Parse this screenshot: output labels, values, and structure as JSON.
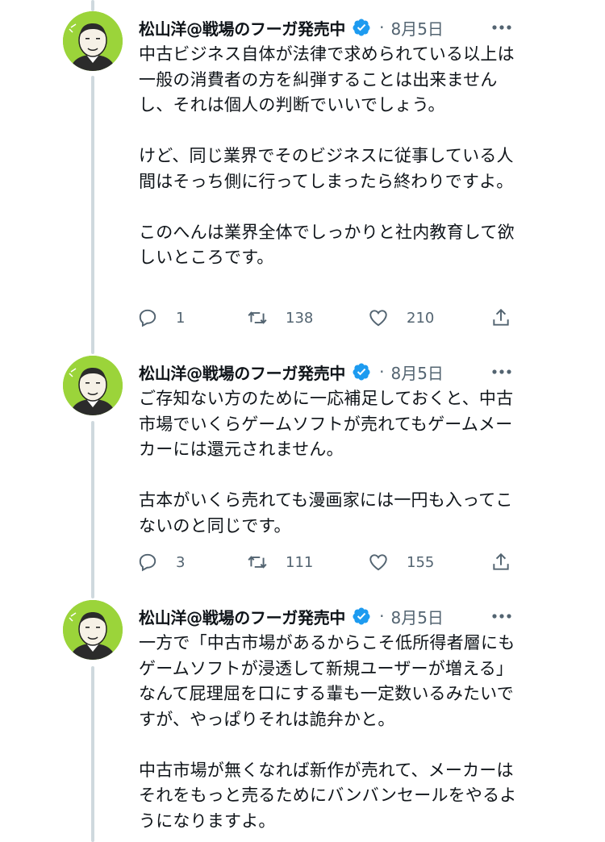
{
  "colors": {
    "verified": "#1d9bf0",
    "secondary_text": "#536471",
    "thread_line": "#cfd9de",
    "avatar_bg": "#9bd43a"
  },
  "tweets": [
    {
      "author": "松山洋@戦場のフーガ発売中",
      "dot": "·",
      "date": "8月5日",
      "paragraphs": [
        "中古ビジネス自体が法律で求められている以上は一般の消費者の方を糾弾することは出来ませんし、それは個人の判断でいいでしょう。",
        "けど、同じ業界でそのビジネスに従事している人間はそっち側に行ってしまったら終わりですよ。",
        "このへんは業界全体でしっかりと社内教育して欲しいところです。"
      ],
      "replies": "1",
      "retweets": "138",
      "likes": "210"
    },
    {
      "author": "松山洋@戦場のフーガ発売中",
      "dot": "·",
      "date": "8月5日",
      "paragraphs": [
        "ご存知ない方のために一応補足しておくと、中古市場でいくらゲームソフトが売れてもゲームメーカーには還元されません。",
        "古本がいくら売れても漫画家には一円も入ってこないのと同じです。"
      ],
      "replies": "3",
      "retweets": "111",
      "likes": "155"
    },
    {
      "author": "松山洋@戦場のフーガ発売中",
      "dot": "·",
      "date": "8月5日",
      "paragraphs": [
        "一方で「中古市場があるからこそ低所得者層にもゲームソフトが浸透して新規ユーザーが増える」なんて屁理屈を口にする輩も一定数いるみたいですが、やっぱりそれは詭弁かと。",
        "中古市場が無くなれば新作が売れて、メーカーはそれをもっと売るためにバンバンセールをやるようになりますよ。"
      ]
    }
  ]
}
